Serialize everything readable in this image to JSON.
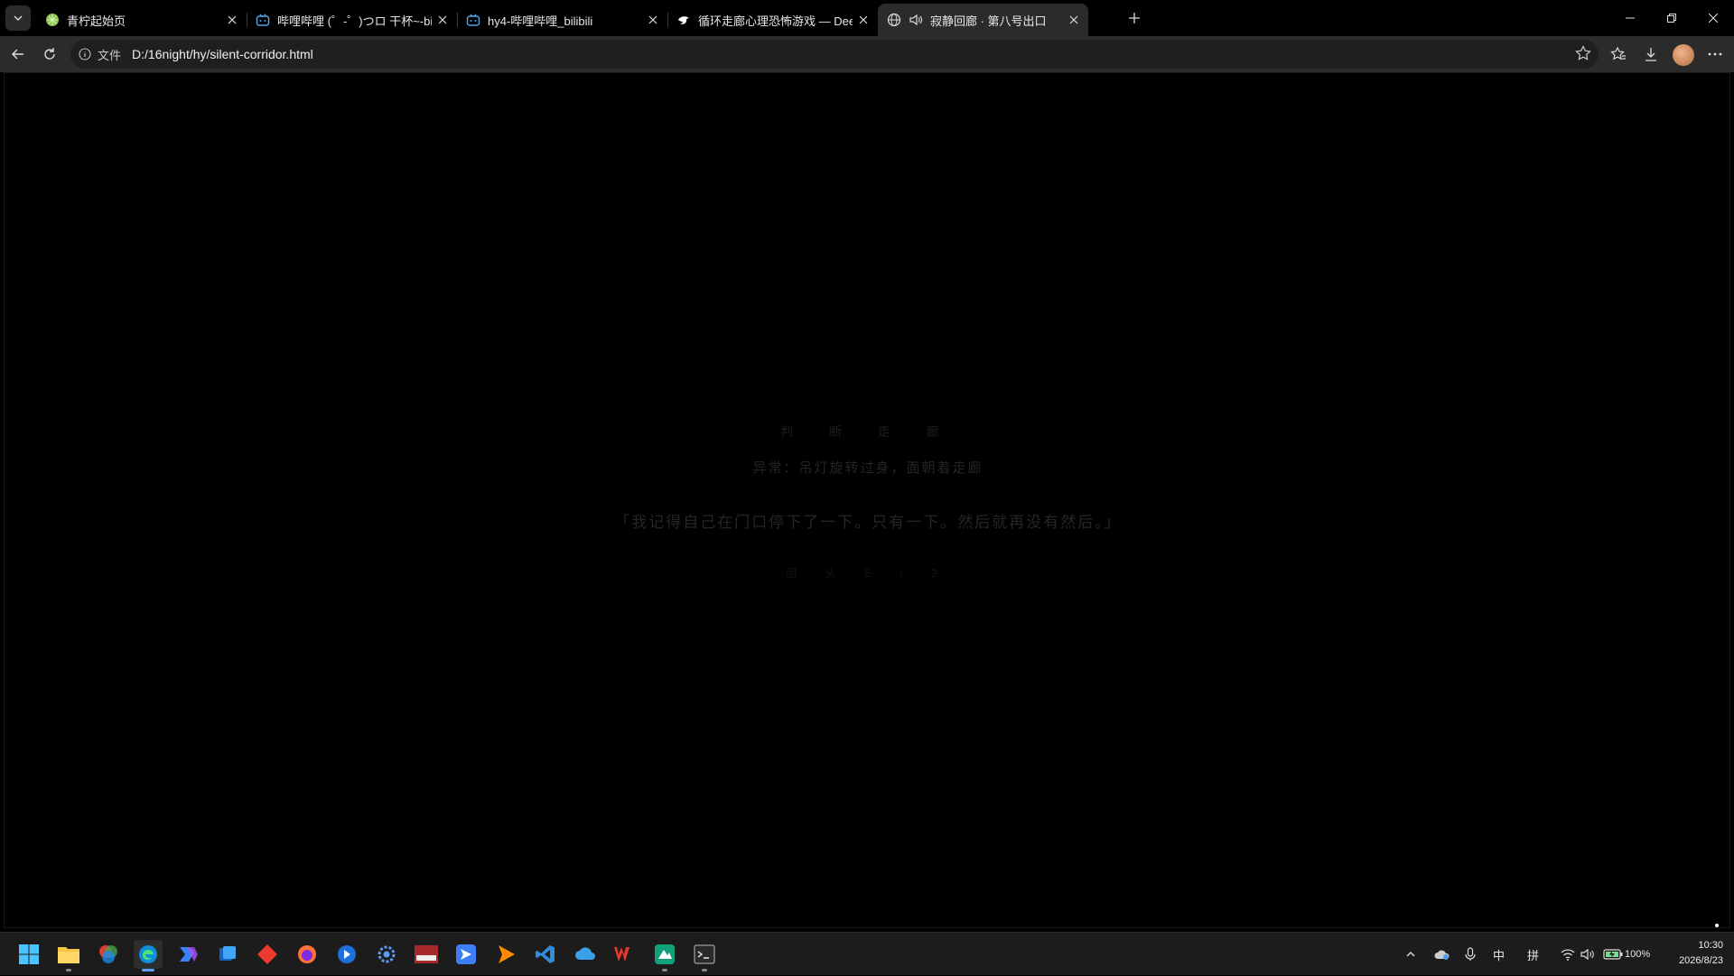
{
  "browser": {
    "tabs": [
      {
        "title": "青柠起始页",
        "icon": "lemon-icon",
        "active": false
      },
      {
        "title": "哔哩哔哩 (゜-゜)つロ 干杯~-bilibili",
        "icon": "bilibili-icon",
        "active": false
      },
      {
        "title": "hy4-哔哩哔哩_bilibili",
        "icon": "bilibili-icon",
        "active": false
      },
      {
        "title": "循环走廊心理恐怖游戏 — DeepSeek",
        "icon": "deepseek-icon",
        "active": false
      },
      {
        "title": "寂静回廊 · 第八号出口",
        "icon": "globe-icon",
        "active": true,
        "audio": true
      }
    ],
    "address": {
      "scheme_label": "文件",
      "url": "D:/16night/hy/silent-corridor.html"
    }
  },
  "page": {
    "floor_label": "判 断 走 廊",
    "anomaly_text": "异常：吊灯旋转过身，面朝着走廊",
    "quote_text": "「我记得自己在门口停下了一下。只有一下。然后就再没有然后。」",
    "hint_text": "回 头 E / 2"
  },
  "taskbar": {
    "apps": [
      "windows-start-icon",
      "file-explorer-icon",
      "app-colorful-icon",
      "edge-icon",
      "m365-icon",
      "app-blue-icon",
      "app-diamond-icon",
      "firefox-icon",
      "app-bluecircle-icon",
      "settings-gear-icon",
      "voicemeeter-icon",
      "app-dart-icon",
      "app-arrow-icon",
      "vscode-icon",
      "app-cloud-icon",
      "wps-icon",
      "app-green-icon",
      "terminal-icon"
    ],
    "tray": {
      "ime_mode": "中",
      "ime_name": "拼",
      "battery": "100%",
      "time": "10:30",
      "date": "2026/8/23"
    }
  }
}
